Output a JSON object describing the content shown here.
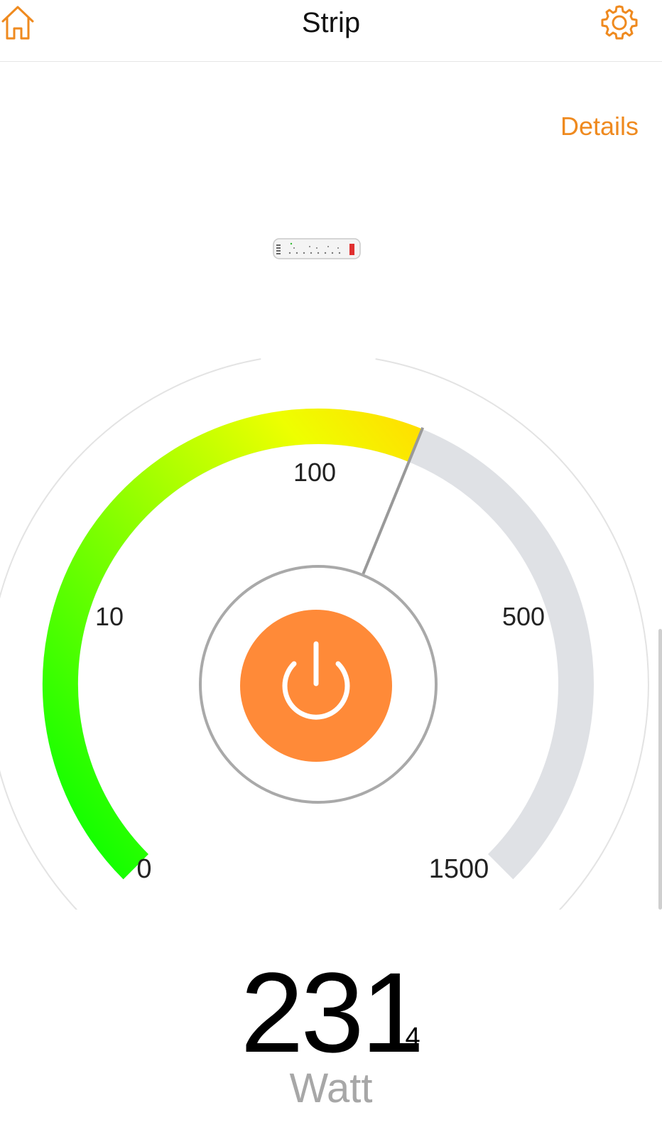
{
  "header": {
    "title": "Strip",
    "home_icon": "home-icon",
    "settings_icon": "gear-icon"
  },
  "details_label": "Details",
  "device_image": "power-strip-icon",
  "gauge": {
    "scale_labels": [
      "0",
      "10",
      "100",
      "500",
      "1500"
    ],
    "current_value": 231.4,
    "needle_color": "#999999",
    "filled_gradient": [
      "#00ff00",
      "#80ff00",
      "#ffff00"
    ],
    "track_color": "#dfe1e5"
  },
  "power_button": {
    "icon": "power-icon",
    "color": "#ff8a38"
  },
  "reading": {
    "integer": "231",
    "fraction": ".4",
    "unit": "Watt"
  },
  "colors": {
    "accent": "#ef8a1f"
  }
}
